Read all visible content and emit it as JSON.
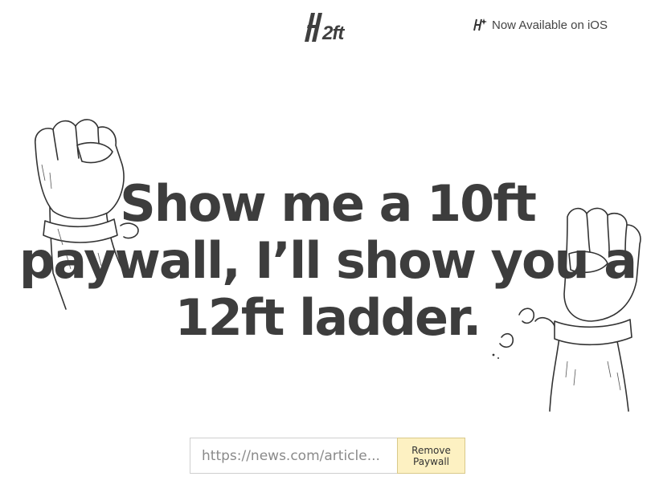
{
  "header": {
    "logo_text": "2ft",
    "ios_link_label": "Now Available on iOS"
  },
  "hero": {
    "headline": "Show me a 10ft paywall, I’ll show you a 12ft ladder."
  },
  "form": {
    "url_placeholder": "https://news.com/article...",
    "url_value": "",
    "submit_label": "Remove Paywall"
  },
  "icons": {
    "ios_icon": "ladder-sparkle-icon",
    "left_illustration": "raised-fist-broken-shackle-icon",
    "right_illustration": "raised-fist-broken-chain-icon"
  }
}
